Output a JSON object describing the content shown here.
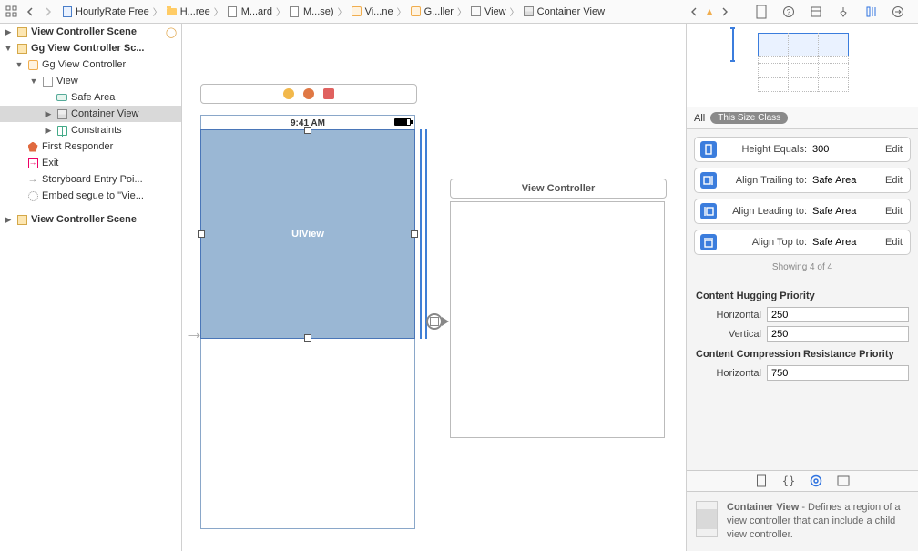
{
  "breadcrumbs": [
    {
      "icon": "file",
      "label": "HourlyRate Free"
    },
    {
      "icon": "folder",
      "label": "H...ree"
    },
    {
      "icon": "doc",
      "label": "M...ard"
    },
    {
      "icon": "doc",
      "label": "M...se)"
    },
    {
      "icon": "viewc",
      "label": "Vi...ne"
    },
    {
      "icon": "viewc",
      "label": "G...ller"
    },
    {
      "icon": "view",
      "label": "View"
    },
    {
      "icon": "cv",
      "label": "Container View"
    }
  ],
  "navigator": {
    "scene1": "View Controller Scene",
    "scene2": "Gg View Controller Sc...",
    "vc": "Gg View Controller",
    "view": "View",
    "safe": "Safe Area",
    "cv": "Container View",
    "constraints": "Constraints",
    "responder": "First Responder",
    "exit": "Exit",
    "entry": "Storyboard Entry Poi...",
    "embed": "Embed segue to \"Vie...",
    "scene3": "View Controller Scene"
  },
  "canvas": {
    "status_time": "9:41 AM",
    "uiview_label": "UIView",
    "vc2_title": "View Controller"
  },
  "inspector": {
    "seg_all": "All",
    "seg_class": "This Size Class",
    "constraints": [
      {
        "name": "Height Equals:",
        "val": "300"
      },
      {
        "name": "Align Trailing to:",
        "val": "Safe Area"
      },
      {
        "name": "Align Leading to:",
        "val": "Safe Area"
      },
      {
        "name": "Align Top to:",
        "val": "Safe Area"
      }
    ],
    "edit": "Edit",
    "showing": "Showing 4 of 4",
    "hugging_title": "Content Hugging Priority",
    "horiz": "Horizontal",
    "vert": "Vertical",
    "hug_h": "250",
    "hug_v": "250",
    "comp_title": "Content Compression Resistance Priority",
    "comp_h": "750",
    "desc_title": "Container View",
    "desc_body": " - Defines a region of a view controller that can include a child view controller."
  }
}
